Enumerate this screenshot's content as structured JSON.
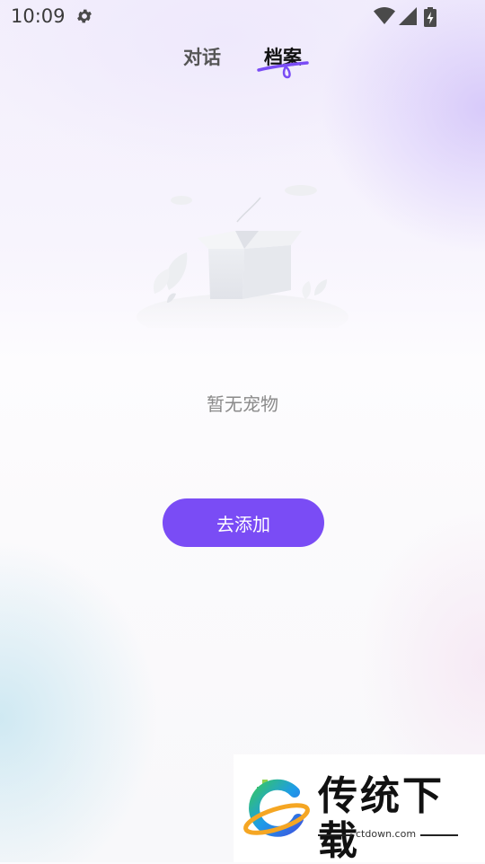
{
  "status_bar": {
    "time": "10:09",
    "icons": [
      "gear-icon",
      "wifi-icon",
      "signal-icon",
      "battery-charging-icon"
    ]
  },
  "tabs": [
    {
      "label": "对话",
      "active": false
    },
    {
      "label": "档案",
      "active": true
    }
  ],
  "empty_state": {
    "icon": "empty-box-illustration",
    "message": "暂无宠物"
  },
  "add_button": {
    "label": "去添加"
  },
  "watermark": {
    "title": "传统下载",
    "url": "ctdown.com",
    "logo": "ctdown-logo"
  },
  "colors": {
    "accent": "#7a4cf5",
    "text_muted": "#8a8a8a"
  }
}
